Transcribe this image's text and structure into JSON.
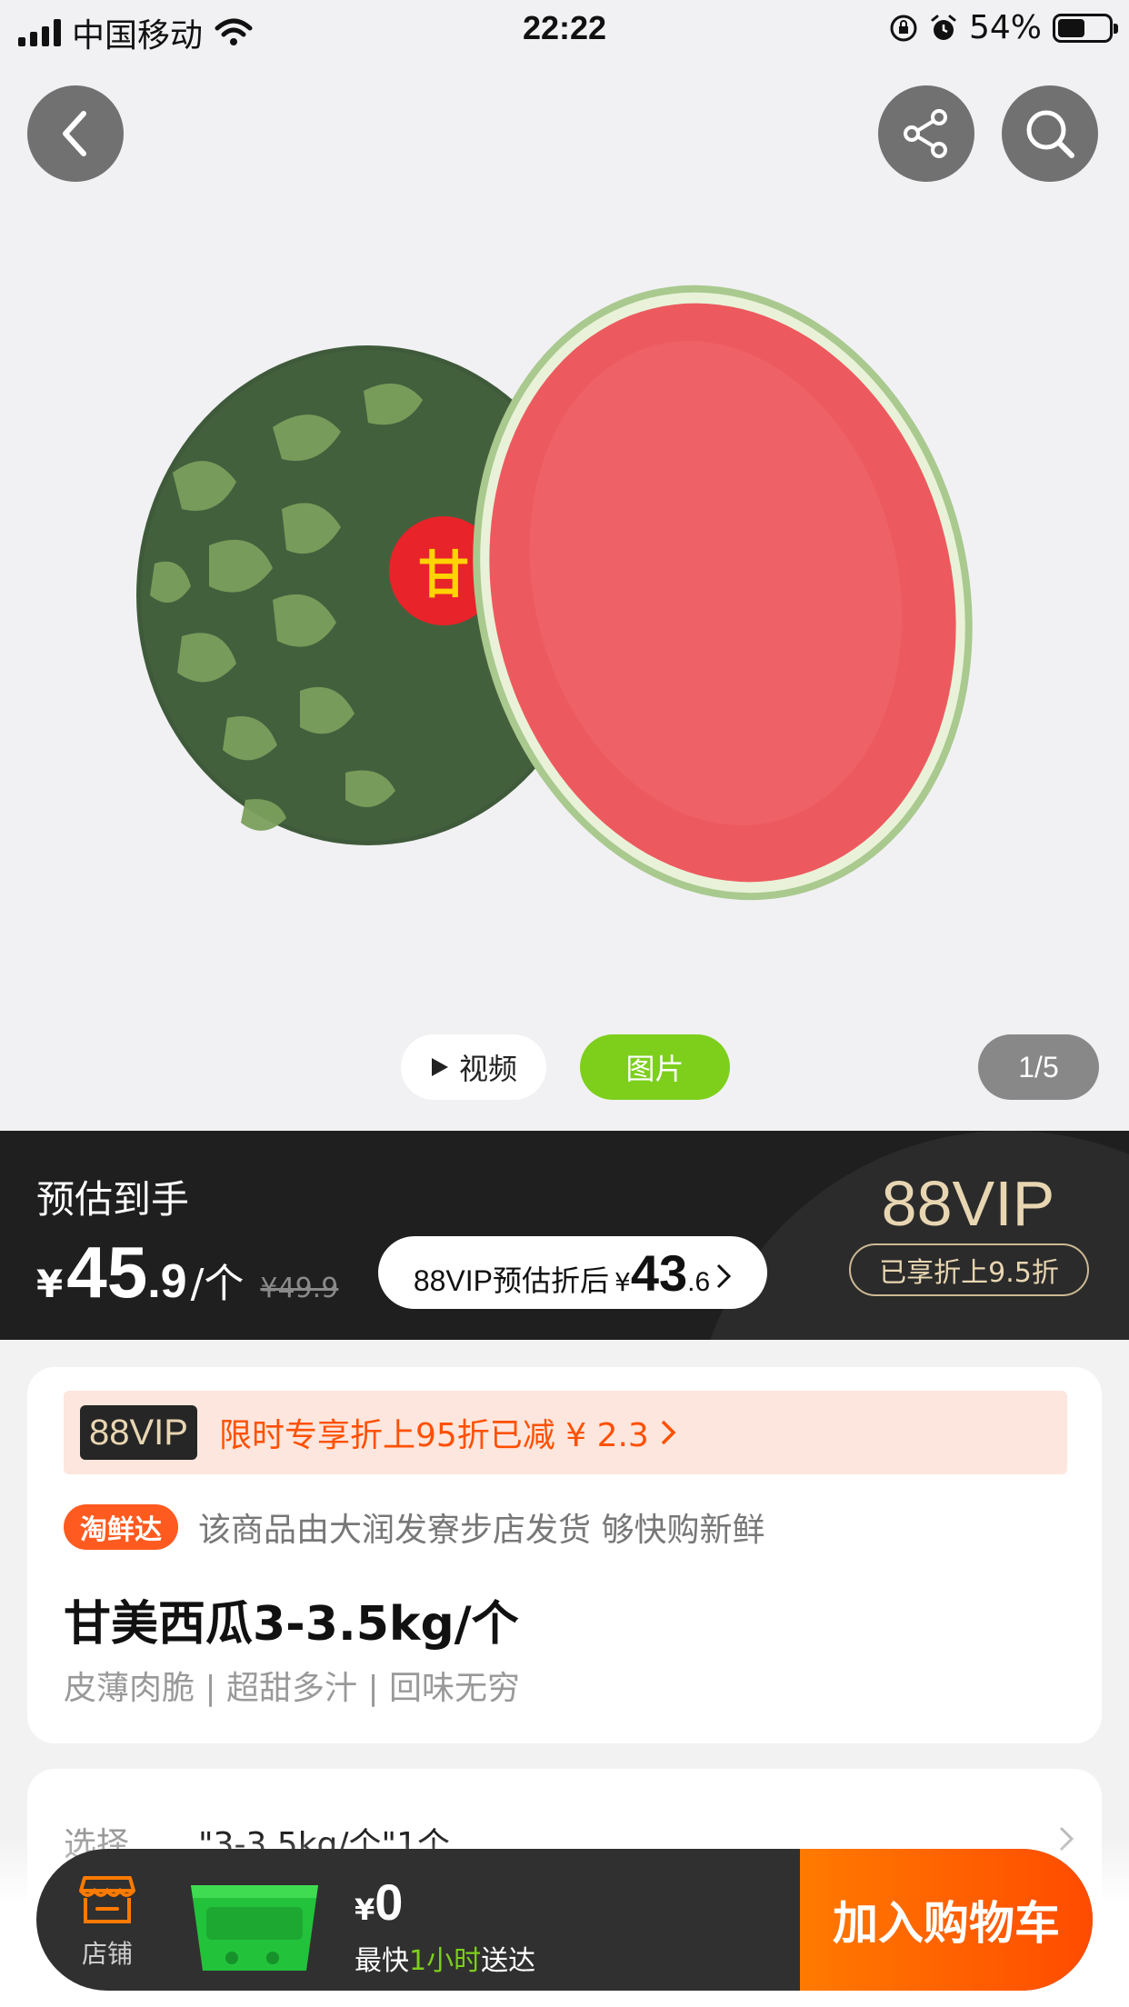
{
  "status_bar": {
    "carrier": "中国移动",
    "time": "22:22",
    "battery_text": "54%",
    "battery_level": 0.54
  },
  "media": {
    "video_label": "视频",
    "image_label": "图片",
    "counter": "1/5",
    "product_sticker_char": "甘"
  },
  "price": {
    "estimate_label": "预估到手",
    "currency": "¥",
    "int": "45",
    "decimal": ".9",
    "unit": "/个",
    "original": "¥49.9",
    "vip_label": "88VIP预估折后",
    "vip_currency": "¥",
    "vip_int": "43",
    "vip_decimal": ".6",
    "vip_logo": "88VIP",
    "vip_discount": "已享折上9.5折"
  },
  "product": {
    "promo_badge": "88VIP",
    "promo_text": "限时专享折上95折已减 ¥ 2.3",
    "fresh_tag": "淘鲜达",
    "seller_text": "该商品由大润发寮步店发货 够快购新鲜",
    "title": "甘美西瓜3-3.5kg/个",
    "subtitle": "皮薄肉脆 | 超甜多汁 | 回味无穷"
  },
  "spec": {
    "label": "选择",
    "value": "\"3-3.5kg/个\"1个"
  },
  "action_bar": {
    "store_label": "店铺",
    "cart_currency": "¥",
    "cart_total": "0",
    "delivery_prefix": "最快",
    "delivery_highlight": "1小时",
    "delivery_suffix": "送达",
    "add_to_cart": "加入购物车"
  },
  "colors": {
    "accent_green": "#7dcf1c",
    "accent_orange": "#ff5000",
    "vip_gold": "#e8d6b2"
  }
}
